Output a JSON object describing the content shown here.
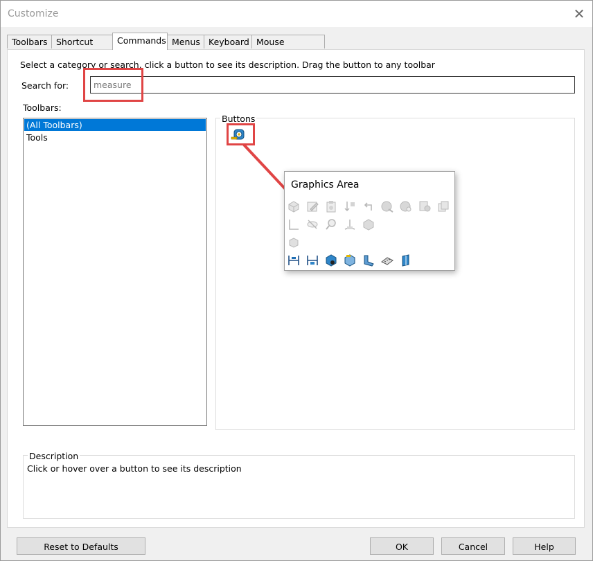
{
  "window": {
    "title": "Customize",
    "close_glyph": "✕"
  },
  "tabs": [
    {
      "label": "Toolbars"
    },
    {
      "label": "Shortcut Bars"
    },
    {
      "label": "Commands",
      "active": true
    },
    {
      "label": "Menus"
    },
    {
      "label": "Keyboard"
    },
    {
      "label": "Mouse Gestures"
    }
  ],
  "instruction": "Select a category or search, click a button to see its description. Drag the button to any toolbar",
  "search": {
    "label": "Search for:",
    "value": "measure"
  },
  "toolbars": {
    "label": "Toolbars:",
    "items": [
      {
        "label": "(All Toolbars)",
        "selected": true
      },
      {
        "label": "Tools",
        "selected": false
      }
    ]
  },
  "buttons_group": {
    "label": "Buttons",
    "result_icon": "measure-tape-icon"
  },
  "popup": {
    "title": "Graphics Area",
    "icons": [
      "box-view-icon",
      "edit-sketch-icon",
      "clipboard-icon",
      "sort-arrows-icon",
      "undo-arrow-icon",
      "globe-icon",
      "globe-settings-icon",
      "part-appearance-icon",
      "copy-view-icon",
      "corner-bracket-icon",
      "hide-eye-icon",
      "zoom-icon",
      "triad-axes-icon",
      "cube-icon",
      "cylinder-icon",
      "measure-linear-icon",
      "measure-dimension-icon",
      "mass-properties-icon",
      "section-properties-icon",
      "check-geometry-icon",
      "ruler-icon",
      "plane-measure-icon"
    ]
  },
  "description": {
    "label": "Description",
    "text": "Click or hover over a button to see its description"
  },
  "footer": {
    "reset": "Reset to Defaults",
    "ok": "OK",
    "cancel": "Cancel",
    "help": "Help"
  },
  "colors": {
    "accent": "#0078d7",
    "highlight": "#e04545",
    "disabled_icon": "#c8c8c8",
    "icon_blue": "#1f6fb5"
  }
}
